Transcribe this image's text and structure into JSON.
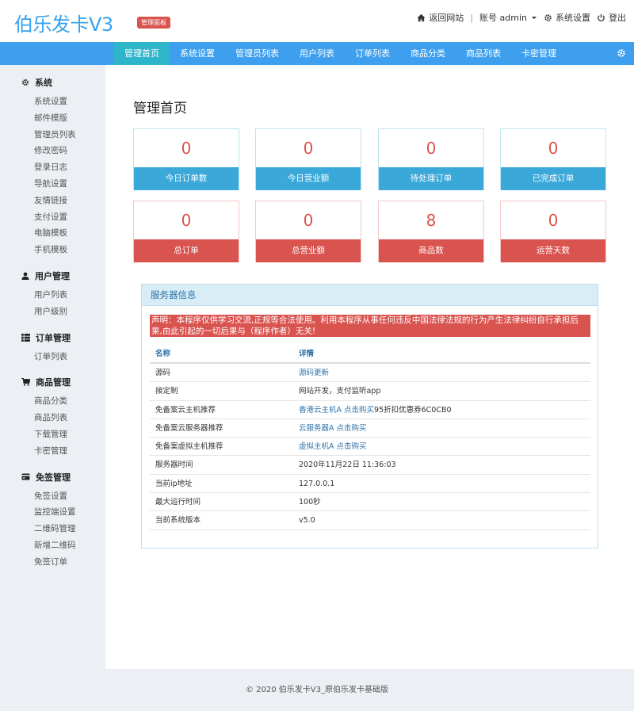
{
  "header": {
    "logo": "伯乐发卡V3",
    "badge": "管理面板",
    "back_site": "返回网站",
    "account": "账号 admin",
    "settings": "系统设置",
    "logout": "登出"
  },
  "nav": {
    "items": [
      "管理首页",
      "系统设置",
      "管理员列表",
      "用户列表",
      "订单列表",
      "商品分类",
      "商品列表",
      "卡密管理"
    ]
  },
  "sidebar": {
    "groups": [
      {
        "title": "系统",
        "icon": "gear-icon",
        "links": [
          "系统设置",
          "邮件模版",
          "管理员列表",
          "修改密码",
          "登录日志",
          "导航设置",
          "友情链接",
          "支付设置",
          "电脑模板",
          "手机模板"
        ]
      },
      {
        "title": "用户管理",
        "icon": "user-icon",
        "links": [
          "用户列表",
          "用户级别"
        ]
      },
      {
        "title": "订单管理",
        "icon": "list-icon",
        "links": [
          "订单列表"
        ]
      },
      {
        "title": "商品管理",
        "icon": "cart-icon",
        "links": [
          "商品分类",
          "商品列表",
          "下载管理",
          "卡密管理"
        ]
      },
      {
        "title": "免签管理",
        "icon": "card-icon",
        "links": [
          "免签设置",
          "监控端设置",
          "二维码管理",
          "新增二维码",
          "免签订单"
        ]
      }
    ]
  },
  "main": {
    "title": "管理首页",
    "stats_top": [
      {
        "value": "0",
        "label": "今日订单数"
      },
      {
        "value": "0",
        "label": "今日营业额"
      },
      {
        "value": "0",
        "label": "待处理订单"
      },
      {
        "value": "0",
        "label": "已完成订单"
      }
    ],
    "stats_bottom": [
      {
        "value": "0",
        "label": "总订单"
      },
      {
        "value": "0",
        "label": "总营业额"
      },
      {
        "value": "8",
        "label": "商品数"
      },
      {
        "value": "0",
        "label": "运营天数"
      }
    ],
    "panel": {
      "title": "服务器信息",
      "notice": "声明：本程序仅供学习交流,正规等合法使用。利用本程序从事任何违反中国法律法规的行为产生法律纠纷自行承担后果,由此引起的一切后果与（程序作者）无关!",
      "col_name": "名称",
      "col_detail": "详情",
      "rows": [
        {
          "name": "源码",
          "link": "源码更新",
          "text": ""
        },
        {
          "name": "接定制",
          "link": "",
          "text": "网站开发，支付监听app"
        },
        {
          "name": "免备案云主机推荐",
          "link": "香港云主机A 点击购买",
          "text": "95折扣优惠券6C0CB0"
        },
        {
          "name": "免备案云服务器推荐",
          "link": "云服务器A 点击购买",
          "text": ""
        },
        {
          "name": "免备案虚拟主机推荐",
          "link": "虚拟主机A 点击购买",
          "text": ""
        },
        {
          "name": "服务器时间",
          "link": "",
          "text": "2020年11月22日 11:36:03"
        },
        {
          "name": "当前ip地址",
          "link": "",
          "text": "127.0.0.1"
        },
        {
          "name": "最大运行时间",
          "link": "",
          "text": "100秒"
        },
        {
          "name": "当前系统版本",
          "link": "",
          "text": "v5.0"
        }
      ]
    }
  },
  "footer": {
    "text": "©  2020 伯乐发卡V3_原伯乐发卡基础版"
  },
  "colors": {
    "primary": "#3d9fee",
    "nav_active": "#2fb5c9",
    "danger": "#d9534f",
    "info": "#3aa8d8"
  }
}
